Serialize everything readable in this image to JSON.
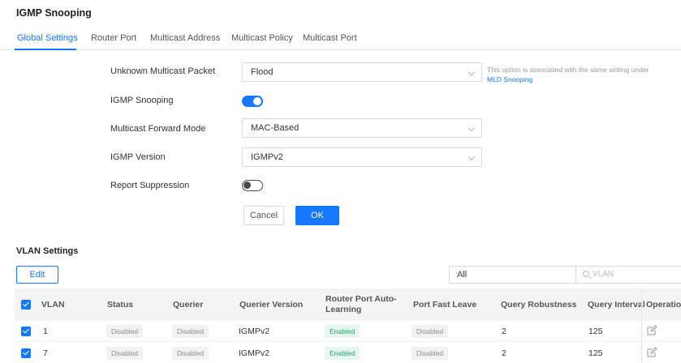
{
  "page": {
    "title": "IGMP Snooping"
  },
  "tabs": [
    {
      "label": "Global Settings",
      "active": true
    },
    {
      "label": "Router Port",
      "active": false
    },
    {
      "label": "Multicast Address",
      "active": false
    },
    {
      "label": "Multicast Policy",
      "active": false
    },
    {
      "label": "Multicast Port",
      "active": false
    }
  ],
  "form": {
    "unknown_multicast_packet": {
      "label": "Unknown Multicast Packet",
      "value": "Flood"
    },
    "hint": {
      "text": "This option is associated with the same setting under",
      "link": "MLD Snooping"
    },
    "igmp_snooping": {
      "label": "IGMP Snooping",
      "enabled": true
    },
    "multicast_forward_mode": {
      "label": "Multicast Forward Mode",
      "value": "MAC-Based"
    },
    "igmp_version": {
      "label": "IGMP Version",
      "value": "IGMPv2"
    },
    "report_suppression": {
      "label": "Report Suppression",
      "enabled": false
    },
    "cancel_label": "Cancel",
    "ok_label": "OK"
  },
  "vlan": {
    "title": "VLAN Settings",
    "edit_label": "Edit",
    "filter_value": "All",
    "search_placeholder": "VLAN",
    "columns": [
      "VLAN",
      "Status",
      "Querier",
      "Querier Version",
      "Router Port Auto-",
      "Learning",
      "Port Fast Leave",
      "Query Robustness",
      "Query Interval",
      "Operation"
    ],
    "rows": [
      {
        "vlan": "1",
        "status": "Disabled",
        "querier": "Disabled",
        "querier_version": "IGMPv2",
        "router_port_auto_learning": "Enabled",
        "port_fast_leave": "Disabled",
        "query_robustness": "2",
        "query_interval": "125"
      },
      {
        "vlan": "7",
        "status": "Disabled",
        "querier": "Disabled",
        "querier_version": "IGMPv2",
        "router_port_auto_learning": "Enabled",
        "port_fast_leave": "Disabled",
        "query_robustness": "2",
        "query_interval": "125"
      }
    ]
  },
  "colors": {
    "accent": "#1677ff",
    "enabled_badge": "#21a366",
    "disabled_badge": "#8c8c8c"
  },
  "icons": [
    "chevron-down-icon",
    "search-icon",
    "edit-icon",
    "checkbox-checked-icon"
  ]
}
